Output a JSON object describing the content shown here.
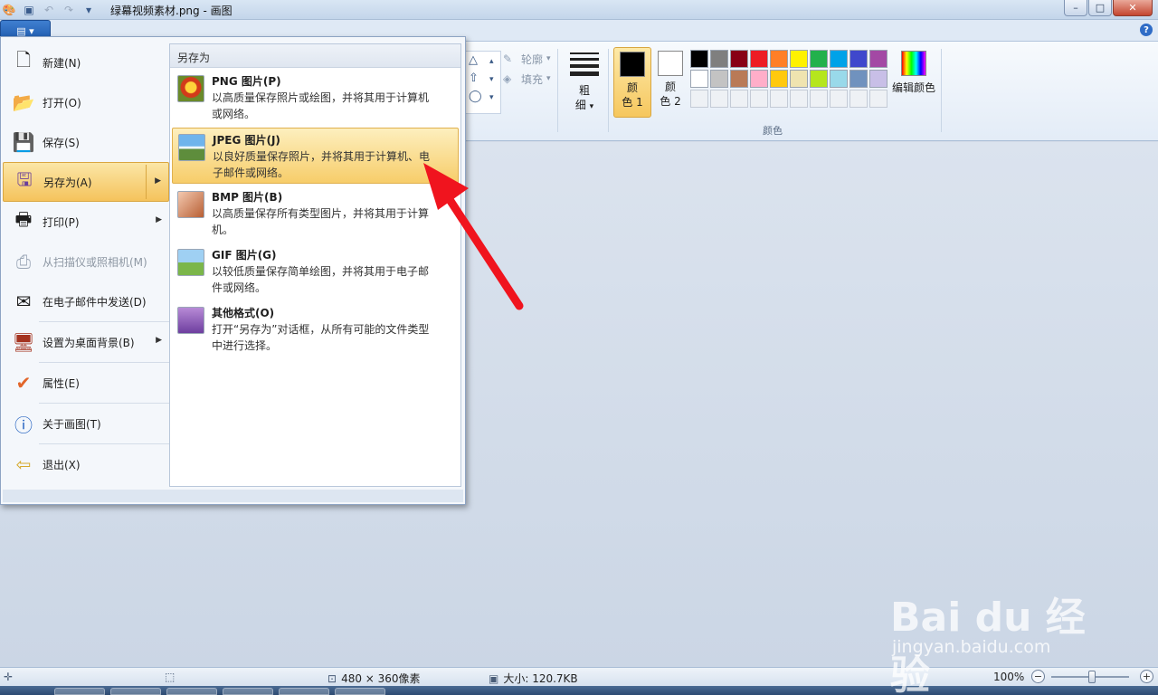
{
  "window": {
    "title": "绿幕视频素材.png - 画图",
    "min_label": "–",
    "max_label": "□",
    "close_label": "✕"
  },
  "ribbon": {
    "help": "?",
    "outline_label": "轮廓",
    "fill_label": "填充",
    "size_label_1": "粗",
    "size_label_2": "细",
    "color1_label_1": "颜",
    "color1_label_2": "色 1",
    "color2_label_1": "颜",
    "color2_label_2": "色 2",
    "edit_colors_label": "编辑颜色",
    "colors_group_label": "颜色",
    "palette_row1": [
      "#000000",
      "#7f7f7f",
      "#880015",
      "#ed1c24",
      "#ff7f27",
      "#fff200",
      "#22b14c",
      "#00a2e8",
      "#3f48cc",
      "#a349a4"
    ],
    "palette_row2": [
      "#ffffff",
      "#c3c3c3",
      "#b97a57",
      "#ffaec9",
      "#ffc90e",
      "#efe4b0",
      "#b5e61d",
      "#99d9ea",
      "#7092be",
      "#c8bfe7"
    ],
    "color1": "#000000",
    "color2": "#ffffff"
  },
  "app_menu": {
    "items": [
      {
        "label": "新建(N)",
        "icon": "new-file-icon"
      },
      {
        "label": "打开(O)",
        "icon": "open-folder-icon"
      },
      {
        "label": "保存(S)",
        "icon": "save-disk-icon"
      },
      {
        "label": "另存为(A)",
        "icon": "save-as-icon"
      },
      {
        "label": "打印(P)",
        "icon": "printer-icon"
      },
      {
        "label": "从扫描仪或照相机(M)",
        "icon": "scanner-icon"
      },
      {
        "label": "在电子邮件中发送(D)",
        "icon": "email-icon"
      },
      {
        "label": "设置为桌面背景(B)",
        "icon": "desktop-background-icon"
      },
      {
        "label": "属性(E)",
        "icon": "checkmark-icon"
      },
      {
        "label": "关于画图(T)",
        "icon": "info-icon"
      },
      {
        "label": "退出(X)",
        "icon": "exit-icon"
      }
    ]
  },
  "save_as_menu": {
    "header": "另存为",
    "items": [
      {
        "title": "PNG 图片(P)",
        "desc": "以高质量保存照片或绘图，并将其用于计算机或网络。"
      },
      {
        "title": "JPEG 图片(J)",
        "desc": "以良好质量保存照片，并将其用于计算机、电子邮件或网络。"
      },
      {
        "title": "BMP 图片(B)",
        "desc": "以高质量保存所有类型图片，并将其用于计算机。"
      },
      {
        "title": "GIF 图片(G)",
        "desc": "以较低质量保存简单绘图，并将其用于电子邮件或网络。"
      },
      {
        "title": "其他格式(O)",
        "desc": "打开“另存为”对话框，从所有可能的文件类型中进行选择。"
      }
    ]
  },
  "statusbar": {
    "dimensions": "480 × 360像素",
    "size": "大小: 120.7KB",
    "zoom": "100%",
    "zoom_percent": 100
  },
  "watermark": {
    "brand": "Bai du 经验",
    "url": "jingyan.baidu.com"
  }
}
